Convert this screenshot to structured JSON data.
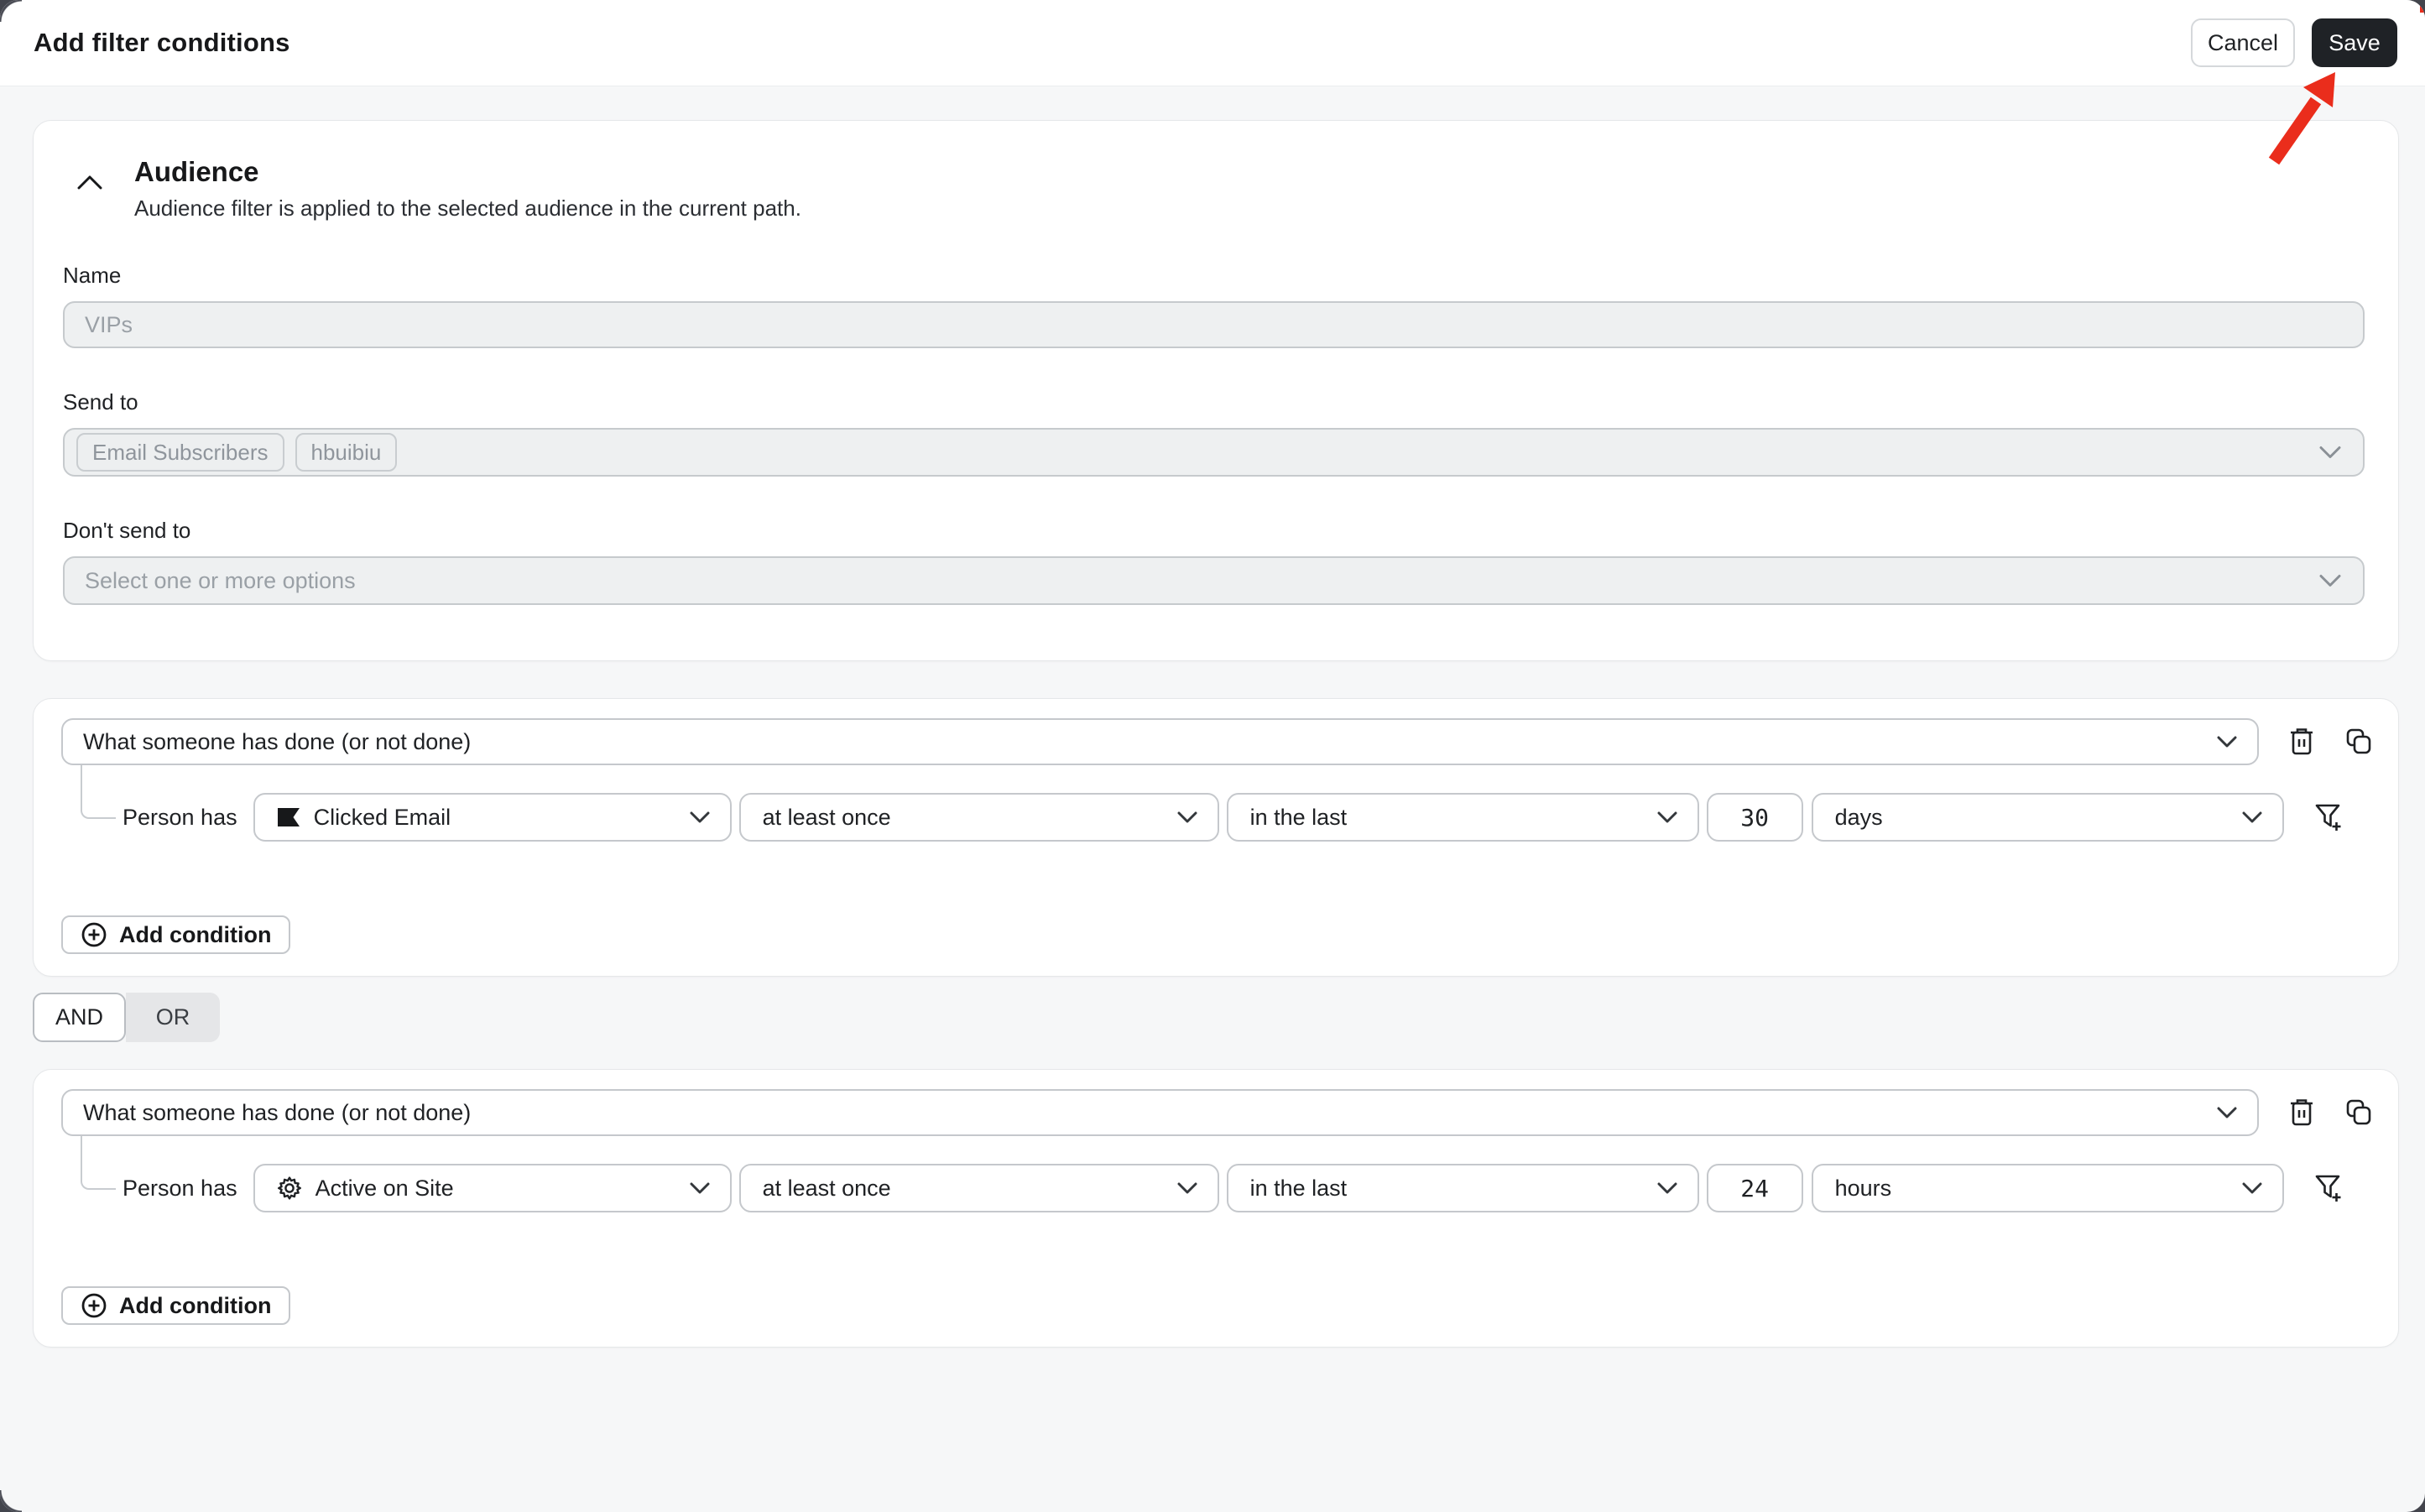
{
  "header": {
    "title": "Add filter conditions",
    "cancel_label": "Cancel",
    "save_label": "Save"
  },
  "audience": {
    "title": "Audience",
    "description": "Audience filter is applied to the selected audience in the current path.",
    "name_label": "Name",
    "name_placeholder": "VIPs",
    "name_value": "",
    "send_to_label": "Send to",
    "send_to_tags": [
      "Email Subscribers",
      "hbuibiu"
    ],
    "dont_send_to_label": "Don't send to",
    "dont_send_to_placeholder": "Select one or more options"
  },
  "logic": {
    "and_label": "AND",
    "or_label": "OR",
    "selected": "AND"
  },
  "conditions": [
    {
      "type_selector": "What someone has done (or not done)",
      "subject_label": "Person has",
      "event": "Clicked Email",
      "event_icon": "flag-icon",
      "frequency": "at least once",
      "timeframe": "in the last",
      "amount": "30",
      "unit": "days",
      "add_label": "Add condition"
    },
    {
      "type_selector": "What someone has done (or not done)",
      "subject_label": "Person has",
      "event": "Active on Site",
      "event_icon": "gear-icon",
      "frequency": "at least once",
      "timeframe": "in the last",
      "amount": "24",
      "unit": "hours",
      "add_label": "Add condition"
    }
  ],
  "icons": {
    "collapse": "chevron-up-icon",
    "select_expand": "chevron-down-icon",
    "delete": "trash-icon",
    "duplicate": "copy-icon",
    "filter_add": "filter-plus-icon",
    "add": "plus-circle-icon"
  },
  "colors": {
    "save_button_bg": "#1f2226",
    "page_bg": "#f6f7f8",
    "card_bg": "#ffffff",
    "input_bg": "#eef0f1",
    "annotation_red": "#ea2d1c"
  }
}
